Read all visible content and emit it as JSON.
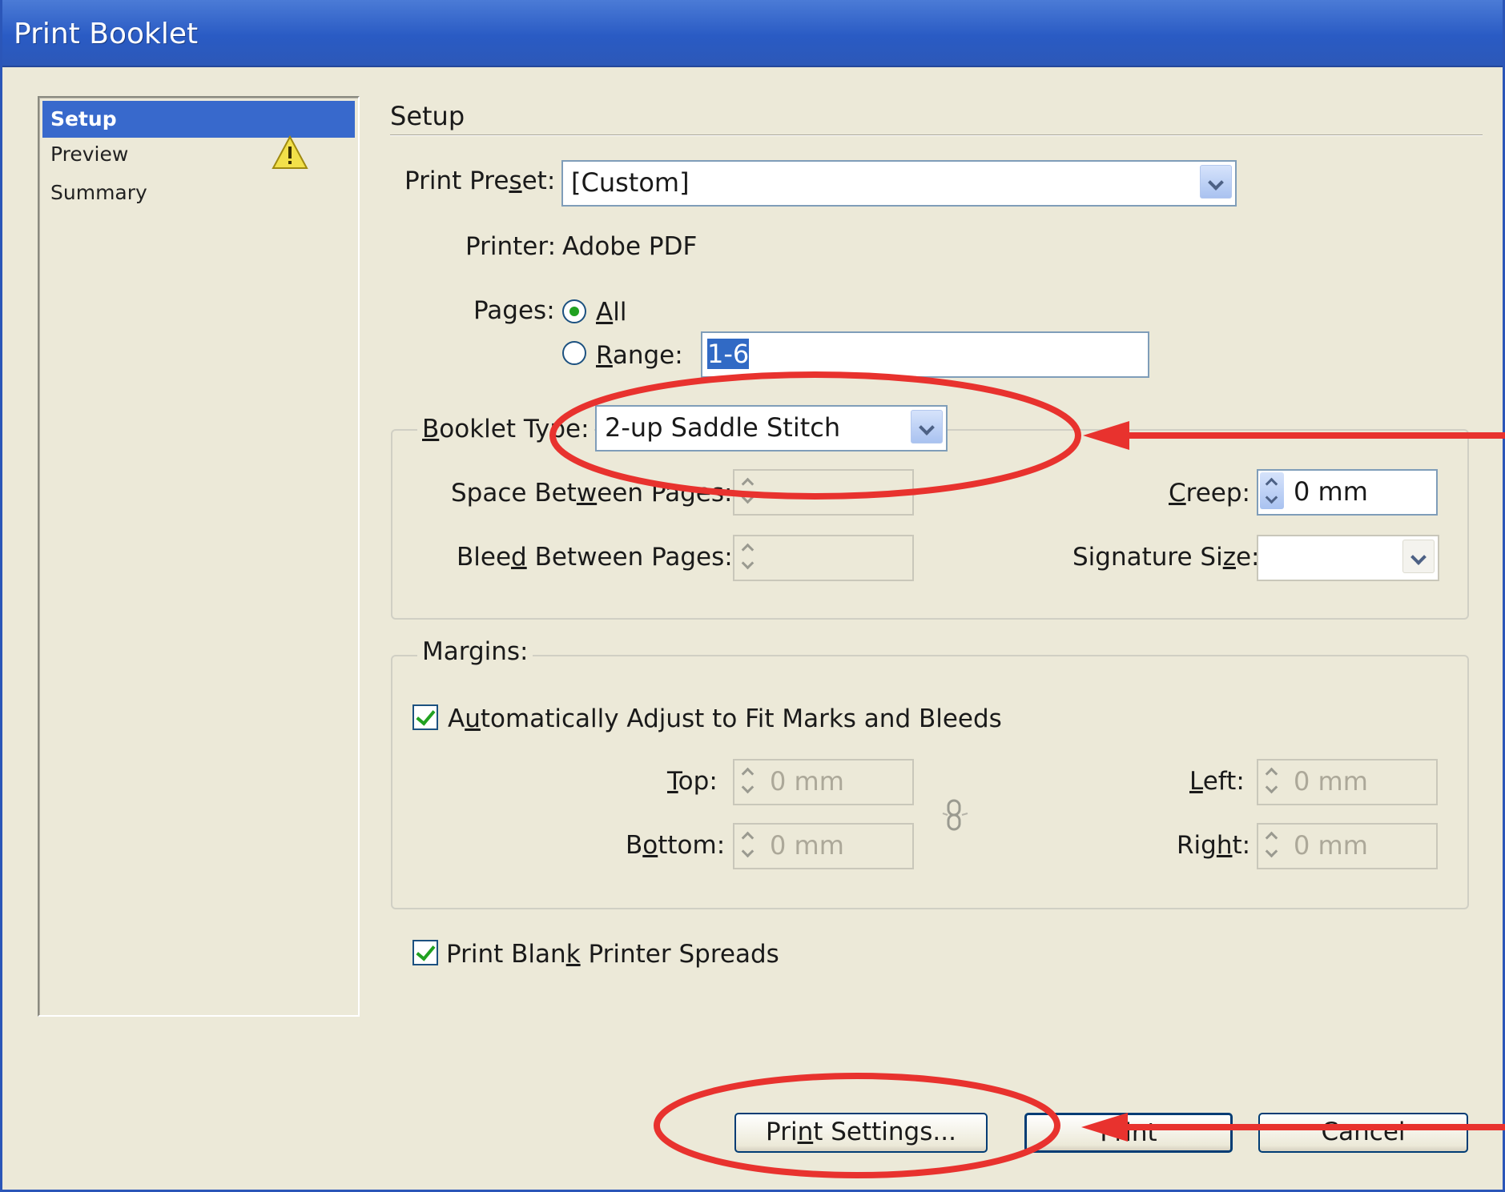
{
  "window": {
    "title": "Print Booklet"
  },
  "nav": {
    "items": [
      {
        "label": "Setup",
        "active": true
      },
      {
        "label": "Preview",
        "warning": true
      },
      {
        "label": "Summary"
      }
    ]
  },
  "setup": {
    "section_title": "Setup",
    "print_preset": {
      "label_pre": "Print Pre",
      "label_u": "s",
      "label_post": "et:",
      "value": "[Custom]"
    },
    "printer": {
      "label": "Printer:",
      "value": "Adobe PDF"
    },
    "pages": {
      "label": "Pages:",
      "all": {
        "u": "A",
        "rest": "ll",
        "selected": true
      },
      "range": {
        "u": "R",
        "rest": "ange:",
        "selected": false,
        "value": "1-6"
      }
    },
    "booklet": {
      "type_label_u": "B",
      "type_label_rest": "ooklet Type:",
      "type_value": "2-up Saddle Stitch",
      "space_between": {
        "pre": "Space Bet",
        "u": "w",
        "post": "een Pages:",
        "value": ""
      },
      "bleed_between": {
        "pre": "Blee",
        "u": "d",
        "post": " Between Pages:",
        "value": ""
      },
      "creep": {
        "u": "C",
        "rest": "reep:",
        "value": "0 mm"
      },
      "signature_size": {
        "pre": "Signature Si",
        "u": "z",
        "post": "e:",
        "value": ""
      }
    },
    "margins": {
      "legend": "Margins:",
      "auto_adjust": {
        "pre": "A",
        "u": "u",
        "post": "tomatically Adjust to Fit Marks and Bleeds",
        "checked": true
      },
      "top": {
        "u": "T",
        "rest": "op:",
        "value": "0 mm"
      },
      "bottom": {
        "pre": "B",
        "u": "o",
        "post": "ttom:",
        "value": "0 mm"
      },
      "left": {
        "u": "L",
        "rest": "eft:",
        "value": "0 mm"
      },
      "right": {
        "pre": "Rig",
        "u": "h",
        "post": "t:",
        "value": "0 mm"
      }
    },
    "print_blank": {
      "pre": "Print Blan",
      "u": "k",
      "post": " Printer Spreads",
      "checked": true
    }
  },
  "buttons": {
    "print_settings": {
      "pre": "Pri",
      "u": "n",
      "post": "t Settings..."
    },
    "print": "Print",
    "cancel": "Cancel"
  },
  "annotation_color": "#e8322e",
  "accent_color": "#316ac5",
  "title_bar_color": "#2a5bc4"
}
